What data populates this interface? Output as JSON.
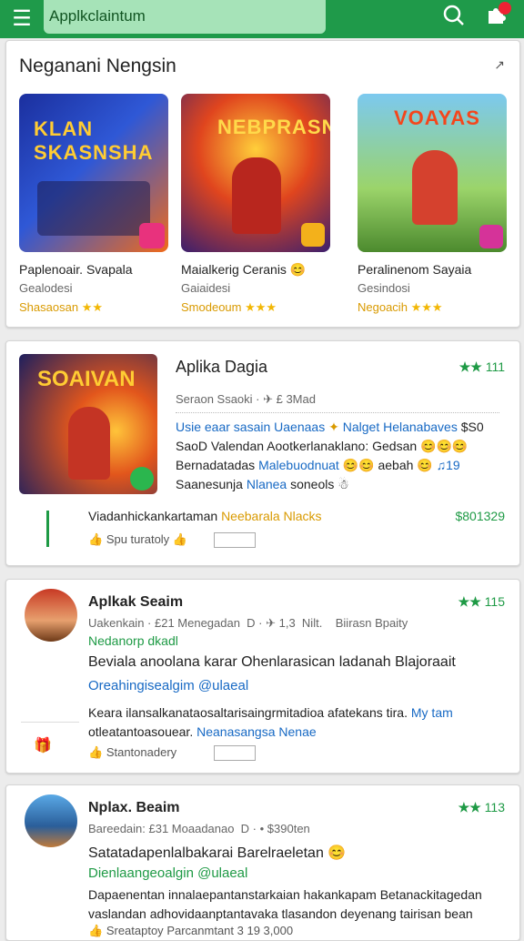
{
  "appbar": {
    "search_text": "Applkclaintum",
    "menu_icon": "menu-icon",
    "search_icon": "search-icon",
    "extension_icon": "puzzle-icon"
  },
  "section": {
    "title": "Neganani Nengsin",
    "more": "↗",
    "games": [
      {
        "logo": "KLAN\nSKASNSHA",
        "name": "Paplenoair. Svapala",
        "sub": "Gealodesi",
        "rating": "Shasaosan",
        "stars": "★★"
      },
      {
        "logo": "NEBPRASN",
        "name": "Maialkerig Ceranis 😊",
        "sub": "Gaiaidesi",
        "rating": "Smodeoum",
        "stars": "★★★"
      },
      {
        "logo": "VOAYAS",
        "name": "Peralinenom Sayaia",
        "sub": "Gesindosi",
        "rating": "Negoacih",
        "stars": "★★★"
      }
    ]
  },
  "review1": {
    "logo": "SOAIVAN",
    "title": "Aplika Dagia",
    "score_stars": "★★",
    "score": "111",
    "meta": "Seraon Ssaoki · ✈ £ 3Mad",
    "line1a": "Usie eaar sasain Uaenaas",
    "line1b": "Nalget Helanabaves",
    "line1c": "$S0",
    "line2": "SaoD Valendan Aootkerlanaklano: Gedsan 😊😊😊",
    "line3a": "Bernadatadas",
    "line3b": "Malebuodnuat",
    "line3c": "😊😊 aebah 😊",
    "line3d": "♫19",
    "line4a": "Saanesunja",
    "line4b": "Nlanea",
    "line4c": "soneols ☃",
    "dev": "Viadanhickankartaman",
    "dev_tag": "Neebarala Nlacks",
    "price": "$801329",
    "foot": "Spu turatoly"
  },
  "review2": {
    "title": "Aplkak Seaim",
    "score_stars": "★★",
    "score": "115",
    "meta": "Uakenkain · £21 Menegadan  D · ✈ 1,3  Nilt.    Biirasn Bpaity",
    "tag": "Nedanorp dkadl",
    "headline": "Beviala anoolana karar Ohenlarasican ladanah Blajoraait",
    "link": "Oreahingisealgim @ulaeal",
    "body1a": "Keara ilansalkanataosaltarisaingrmitadioa afatekans tira.",
    "body1b": "My tam",
    "body2a": "otleatantoasouear.",
    "body2b": "Neanasangsa Nenae",
    "foot": "Stantonadery"
  },
  "review3": {
    "title": "Nplax. Beaim",
    "score_stars": "★★",
    "score": "113",
    "meta": "Bareedain: £31 Moaadanao  D · • $390ten",
    "headline": "Satatadapenlalbakarai Barelraeletan 😊",
    "link": "Dienlaangeoalgin @ulaeal",
    "body1": "Dapaenentan innalaepantanstarkaian hakankapam Betanackitagedan",
    "body2": "vaslandan adhovidaanptantavaka tlasandon deyenang tairisan bean",
    "foot": "Sreataptoy",
    "foot2": "Parcanmtant 3 19 3,000"
  },
  "colors": {
    "brand": "#1f9a4a",
    "star_gold": "#f2b705",
    "star_green": "#1e9a45",
    "link": "#1769c4"
  }
}
